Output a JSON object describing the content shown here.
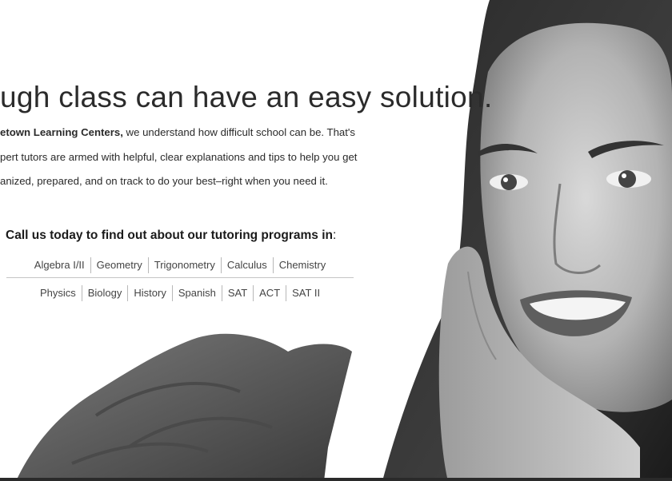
{
  "headline": "ugh class can have an easy solution.",
  "body": {
    "line1_bold": "etown Learning Centers,",
    "line1_rest": " we understand how difficult school can be. That's",
    "line2": "pert tutors are armed with helpful, clear explanations and tips to help you get",
    "line3": "anized, prepared, and on track to do your best–right when you need it."
  },
  "cta": {
    "text": "Call us today to find out about our tutoring programs in",
    "colon": ":"
  },
  "subjects_row1": [
    "Algebra I/II",
    "Geometry",
    "Trigonometry",
    "Calculus",
    "Chemistry"
  ],
  "subjects_row2": [
    "Physics",
    "Biology",
    "History",
    "Spanish",
    "SAT",
    "ACT",
    "SAT II"
  ],
  "colors": {
    "text": "#2b2b2b",
    "divider": "#c5c5c5",
    "background": "#ffffff"
  }
}
